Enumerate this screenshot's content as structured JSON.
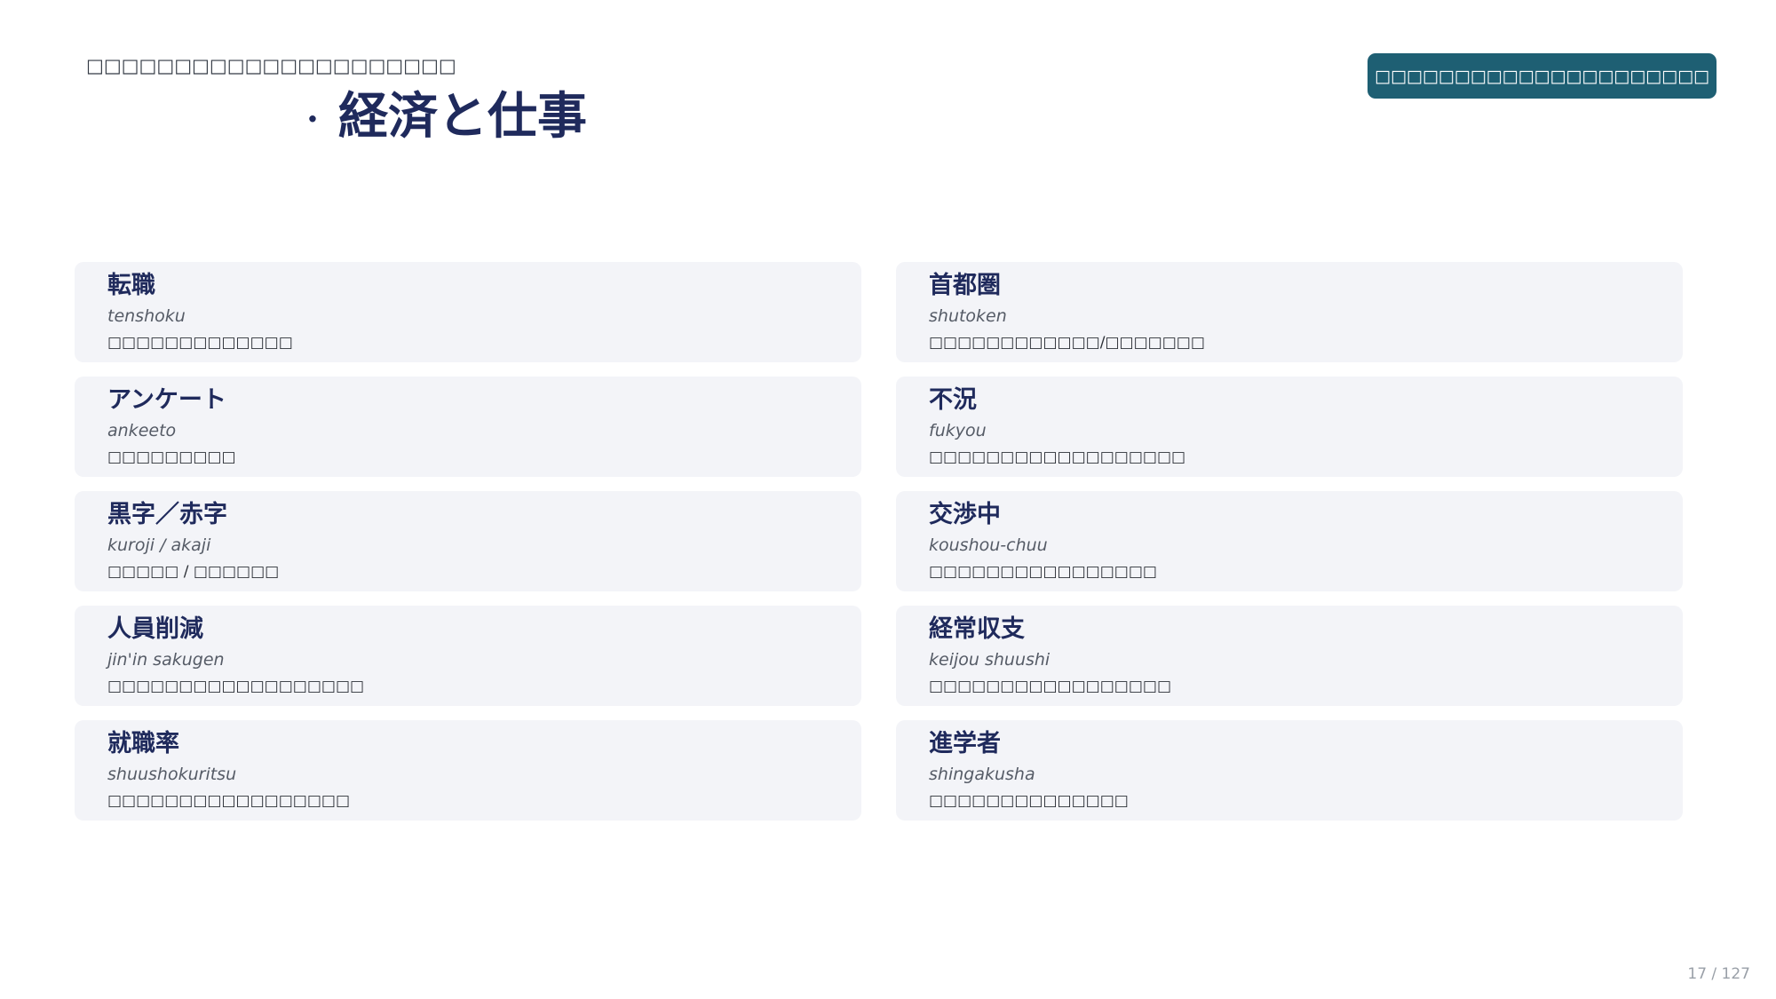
{
  "header": {
    "subtitle": "□□□□□□□□□□□□□□□□□□□□□",
    "title_bullet": "·",
    "title": "経済と仕事",
    "button_label": "□□□□□□□□□□□□□□□□□□□□□"
  },
  "vocab": [
    {
      "term": "転職",
      "reading": "tenshoku",
      "meaning": "□□□□□□□□□□□□□"
    },
    {
      "term": "首都圏",
      "reading": "shutoken",
      "meaning": "□□□□□□□□□□□□/□□□□□□□"
    },
    {
      "term": "アンケート",
      "reading": "ankeeto",
      "meaning": "□□□□□□□□□"
    },
    {
      "term": "不況",
      "reading": "fukyou",
      "meaning": "□□□□□□□□□□□□□□□□□□"
    },
    {
      "term": "黒字／赤字",
      "reading": "kuroji / akaji",
      "meaning": "□□□□□ / □□□□□□"
    },
    {
      "term": "交渉中",
      "reading": "koushou-chuu",
      "meaning": "□□□□□□□□□□□□□□□□"
    },
    {
      "term": "人員削減",
      "reading": "jin'in sakugen",
      "meaning": "□□□□□□□□□□□□□□□□□□"
    },
    {
      "term": "経常収支",
      "reading": "keijou shuushi",
      "meaning": "□□□□□□□□□□□□□□□□□"
    },
    {
      "term": "就職率",
      "reading": "shuushokuritsu",
      "meaning": "□□□□□□□□□□□□□□□□□"
    },
    {
      "term": "進学者",
      "reading": "shingakusha",
      "meaning": "□□□□□□□□□□□□□□"
    }
  ],
  "footer": {
    "page_number": "17 / 127"
  }
}
